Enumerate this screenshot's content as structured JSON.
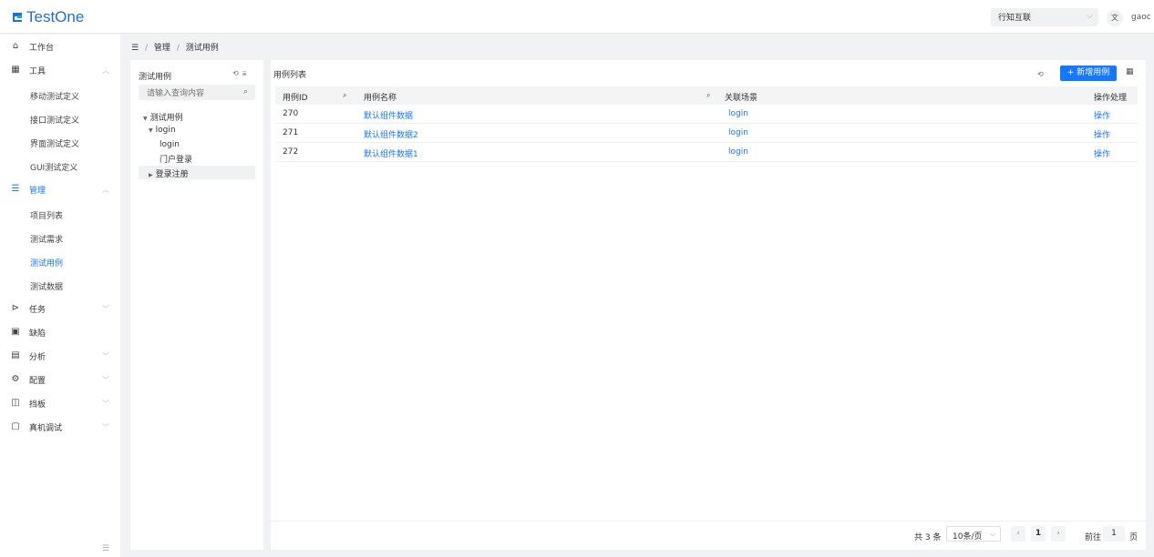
{
  "app": {
    "title": "TestOne"
  },
  "header": {
    "project": "行知互联",
    "lang_icon": "translate-icon",
    "user": "gaoc"
  },
  "sidebar": {
    "items": [
      {
        "label": "工作台",
        "icon": "home-icon"
      },
      {
        "label": "工具",
        "icon": "grid-icon",
        "children": [
          "移动测试定义",
          "接口测试定义",
          "界面测试定义",
          "GUI测试定义"
        ]
      },
      {
        "label": "管理",
        "icon": "list-icon",
        "children": [
          "项目列表",
          "测试需求",
          "测试用例",
          "测试数据"
        ],
        "active_child": "测试用例"
      },
      {
        "label": "任务",
        "icon": "send-icon"
      },
      {
        "label": "缺陷",
        "icon": "bug-icon"
      },
      {
        "label": "分析",
        "icon": "calendar-icon"
      },
      {
        "label": "配置",
        "icon": "settings-icon"
      },
      {
        "label": "挡板",
        "icon": "panel-icon"
      },
      {
        "label": "真机调试",
        "icon": "device-icon"
      }
    ]
  },
  "breadcrumb": {
    "items": [
      "管理",
      "测试用例"
    ]
  },
  "tree": {
    "title": "测试用例",
    "search_placeholder": "请输入查询内容",
    "nodes": [
      "测试用例",
      "login",
      "login",
      "门户登录",
      "登录注册"
    ]
  },
  "main": {
    "title": "用例列表",
    "add_button": "+ 新增用例",
    "columns": [
      "用例ID",
      "用例名称",
      "关联场景",
      "操作处理"
    ],
    "rows": [
      {
        "id": "270",
        "name": "默认组件数据",
        "scene": "login",
        "action": "操作"
      },
      {
        "id": "271",
        "name": "默认组件数据2",
        "scene": "login",
        "action": "操作"
      },
      {
        "id": "272",
        "name": "默认组件数据1",
        "scene": "login",
        "action": "操作"
      }
    ]
  },
  "pager": {
    "total": "共 3 条",
    "page_size": "10条/页",
    "current": "1",
    "goto_label": "前往",
    "goto_value": "1",
    "unit": "页"
  },
  "colors": {
    "accent": "#1677ff",
    "brand": "#1f6fd6"
  }
}
